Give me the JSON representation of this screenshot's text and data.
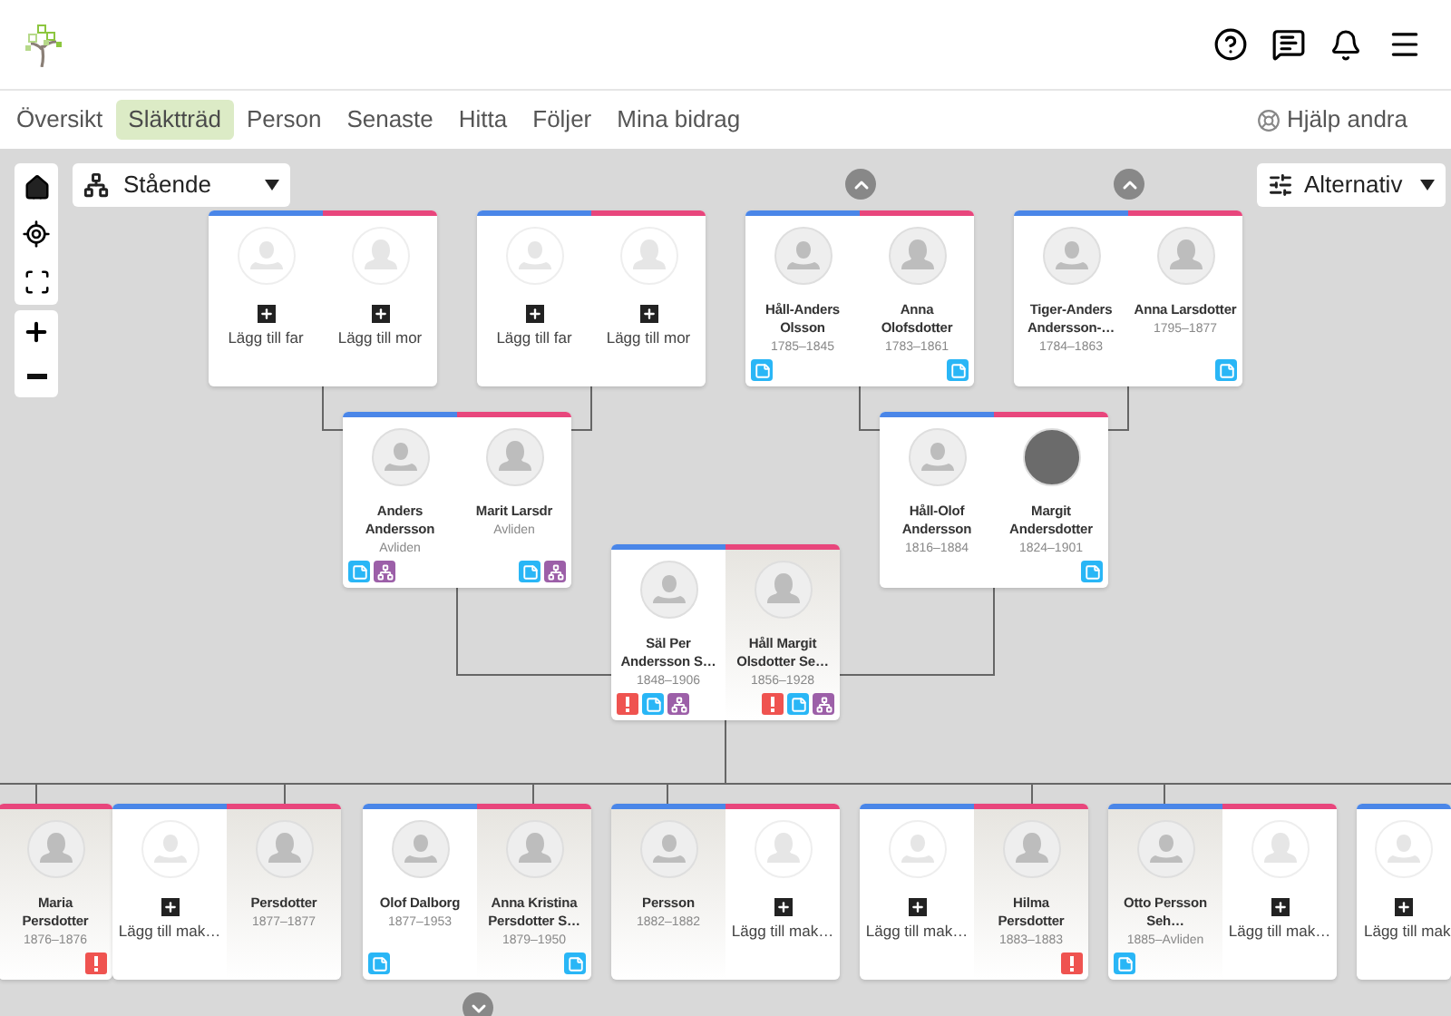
{
  "nav": {
    "tabs": [
      {
        "label": "Översikt",
        "selected": false
      },
      {
        "label": "Släktträd",
        "selected": true
      },
      {
        "label": "Person",
        "selected": false
      },
      {
        "label": "Senaste",
        "selected": false
      },
      {
        "label": "Hitta",
        "selected": false
      },
      {
        "label": "Följer",
        "selected": false
      },
      {
        "label": "Mina bidrag",
        "selected": false
      }
    ],
    "help_link": "Hjälp andra"
  },
  "toolbar": {
    "layout_select": "Stående",
    "options_button": "Alternativ"
  },
  "generations": [
    {
      "couples": [
        {
          "has_parents": false,
          "has_children": false,
          "partners": [
            {
              "kind": "add",
              "color": "#4a86e8",
              "label": "Lägg till far"
            },
            {
              "kind": "add",
              "color": "#e8467c",
              "label": "Lägg till mor"
            }
          ]
        },
        {
          "has_parents": false,
          "has_children": false,
          "partners": [
            {
              "kind": "add",
              "color": "#4a86e8",
              "label": "Lägg till far"
            },
            {
              "kind": "add",
              "color": "#e8467c",
              "label": "Lägg till mor"
            }
          ]
        },
        {
          "has_parents": true,
          "has_children": false,
          "partners": [
            {
              "kind": "person",
              "color": "#4a86e8",
              "name": "Håll-Anders Olsson",
              "years": "1785–1845",
              "highlighted": false,
              "photo": false,
              "badges": [
                {
                  "kind": "notes"
                }
              ]
            },
            {
              "kind": "person",
              "color": "#e8467c",
              "name": "Anna Olofsdotter",
              "years": "1783–1861",
              "highlighted": false,
              "photo": false,
              "badges": [
                {
                  "kind": "notes"
                }
              ]
            }
          ]
        },
        {
          "has_parents": true,
          "has_children": false,
          "partners": [
            {
              "kind": "person",
              "color": "#4a86e8",
              "name": "Tiger-Anders Andersson-…",
              "years": "1784–1863",
              "highlighted": false,
              "photo": false
            },
            {
              "kind": "person",
              "color": "#e8467c",
              "name": "Anna Larsdotter",
              "years": "1795–1877",
              "highlighted": false,
              "photo": false,
              "badges": [
                {
                  "kind": "notes"
                }
              ]
            }
          ]
        }
      ]
    },
    {
      "couples": [
        {
          "has_parents": false,
          "has_children": false,
          "partners": [
            {
              "kind": "person",
              "color": "#4a86e8",
              "name": "Anders Andersson",
              "years": "Avliden",
              "highlighted": false,
              "photo": false,
              "badges": [
                {
                  "kind": "notes"
                },
                {
                  "kind": "tree"
                }
              ]
            },
            {
              "kind": "person",
              "color": "#e8467c",
              "name": "Marit Larsdr",
              "years": "Avliden",
              "highlighted": false,
              "photo": false,
              "badges": [
                {
                  "kind": "notes"
                },
                {
                  "kind": "tree"
                }
              ]
            }
          ]
        },
        {
          "has_parents": false,
          "has_children": false,
          "partners": [
            {
              "kind": "person",
              "color": "#4a86e8",
              "name": "Håll-Olof Andersson",
              "years": "1816–1884",
              "highlighted": false,
              "photo": false
            },
            {
              "kind": "person",
              "color": "#e8467c",
              "name": "Margit Andersdotter",
              "years": "1824–1901",
              "highlighted": false,
              "photo": true,
              "badges": [
                {
                  "kind": "notes"
                }
              ]
            }
          ]
        }
      ]
    },
    {
      "couples": [
        {
          "has_parents": false,
          "has_children": false,
          "partners": [
            {
              "kind": "person",
              "color": "#4a86e8",
              "name": "Säl Per Andersson S…",
              "years": "1848–1906",
              "highlighted": false,
              "photo": false,
              "badges": [
                {
                  "kind": "warning"
                },
                {
                  "kind": "notes"
                },
                {
                  "kind": "tree"
                }
              ]
            },
            {
              "kind": "person",
              "color": "#e8467c",
              "name": "Håll Margit Olsdotter Se…",
              "years": "1856–1928",
              "highlighted": true,
              "photo": false,
              "badges": [
                {
                  "kind": "warning"
                },
                {
                  "kind": "notes"
                },
                {
                  "kind": "tree"
                }
              ]
            }
          ]
        }
      ]
    },
    {
      "couples": [
        {
          "has_parents": false,
          "has_children": false,
          "partners": [
            {
              "kind": "person",
              "color": "#e8467c",
              "name": "Maria Persdotter",
              "years": "1876–1876",
              "highlighted": true,
              "photo": false,
              "badges": [
                {
                  "kind": "warning"
                }
              ]
            }
          ]
        },
        {
          "has_parents": false,
          "has_children": false,
          "partners": [
            {
              "kind": "add",
              "color": "#4a86e8",
              "label": "Lägg till mak…"
            },
            {
              "kind": "person",
              "color": "#e8467c",
              "name": "Persdotter",
              "years": "1877–1877",
              "highlighted": true,
              "photo": false
            }
          ]
        },
        {
          "has_parents": false,
          "has_children": true,
          "partners": [
            {
              "kind": "person",
              "color": "#4a86e8",
              "name": "Olof Dalborg",
              "years": "1877–1953",
              "highlighted": false,
              "photo": false,
              "badges": [
                {
                  "kind": "notes"
                }
              ]
            },
            {
              "kind": "person",
              "color": "#e8467c",
              "name": "Anna Kristina Persdotter S…",
              "years": "1879–1950",
              "highlighted": true,
              "photo": false,
              "badges": [
                {
                  "kind": "notes"
                }
              ]
            }
          ]
        },
        {
          "has_parents": false,
          "has_children": false,
          "partners": [
            {
              "kind": "person",
              "color": "#4a86e8",
              "name": "Persson",
              "years": "1882–1882",
              "highlighted": true,
              "photo": false
            },
            {
              "kind": "add",
              "color": "#e8467c",
              "label": "Lägg till mak…"
            }
          ]
        },
        {
          "has_parents": false,
          "has_children": false,
          "partners": [
            {
              "kind": "add",
              "color": "#4a86e8",
              "label": "Lägg till mak…"
            },
            {
              "kind": "person",
              "color": "#e8467c",
              "name": "Hilma Persdotter",
              "years": "1883–1883",
              "highlighted": true,
              "photo": false,
              "badges": [
                {
                  "kind": "warning"
                }
              ]
            }
          ]
        },
        {
          "has_parents": false,
          "has_children": false,
          "partners": [
            {
              "kind": "person",
              "color": "#4a86e8",
              "name": "Otto Persson Seh…",
              "years": "1885–Avliden",
              "highlighted": true,
              "photo": false,
              "badges": [
                {
                  "kind": "notes"
                }
              ]
            },
            {
              "kind": "add",
              "color": "#e8467c",
              "label": "Lägg till mak…"
            }
          ]
        },
        {
          "has_parents": false,
          "has_children": false,
          "partners": [
            {
              "kind": "add",
              "color": "#4a86e8",
              "label": "Lägg till mak"
            }
          ]
        }
      ]
    }
  ]
}
